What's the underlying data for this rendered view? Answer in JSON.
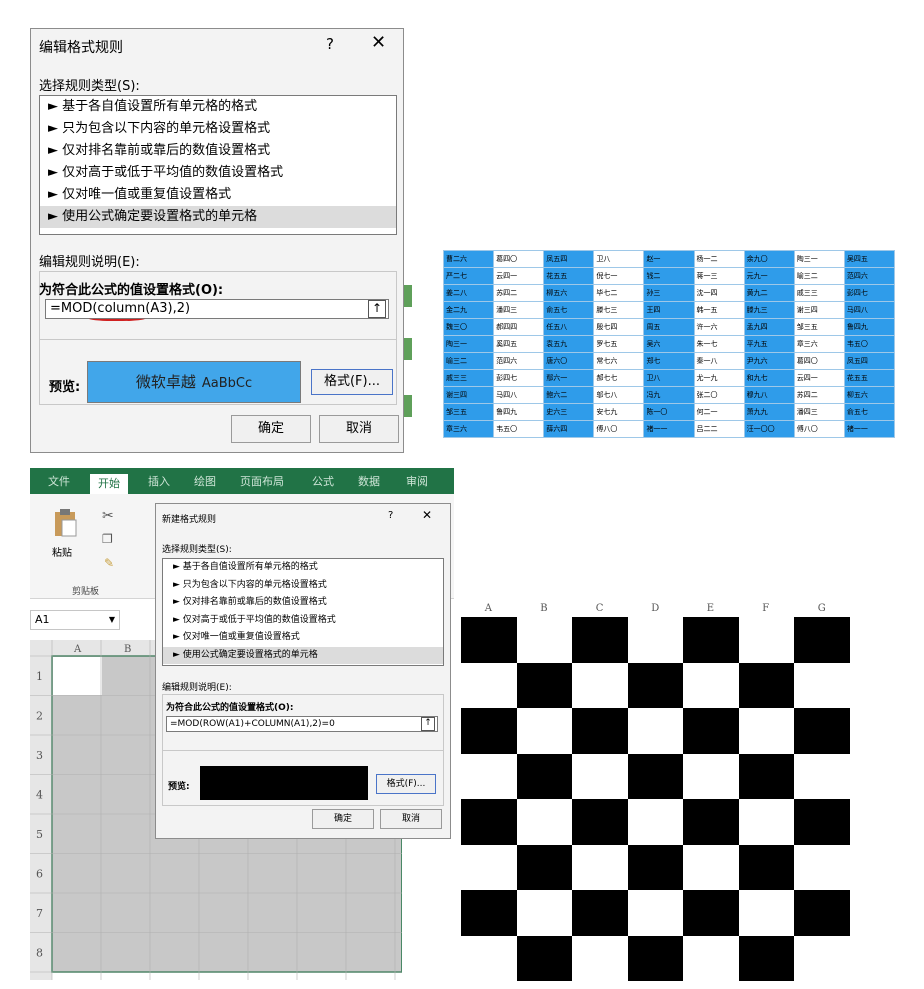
{
  "dialog1": {
    "title": "编辑格式规则",
    "help": "?",
    "close": "✕",
    "select_type_label": "选择规则类型(S):",
    "rule_types": [
      "► 基于各自值设置所有单元格的格式",
      "► 只为包含以下内容的单元格设置格式",
      "► 仅对排名靠前或靠后的数值设置格式",
      "► 仅对高于或低于平均值的数值设置格式",
      "► 仅对唯一值或重复值设置格式",
      "► 使用公式确定要设置格式的单元格"
    ],
    "edit_desc_label": "编辑规则说明(E):",
    "formula_label": "为符合此公式的值设置格式(O):",
    "formula_value": "=MOD(column(A3),2)",
    "preview_label": "预览:",
    "preview_text": "微软卓越",
    "preview_sample": "AaBbCc",
    "preview_color": "#41a6ea",
    "format_button": "格式(F)...",
    "ok_button": "确定",
    "cancel_button": "取消"
  },
  "name_table": {
    "rows": [
      [
        "曹二六",
        "葛四〇",
        "凤五四",
        "卫八",
        "赵一",
        "杨一二",
        "余九〇",
        "陶三一",
        "吴四五"
      ],
      [
        "严二七",
        "云四一",
        "花五五",
        "倪七一",
        "钱二",
        "蒋一三",
        "元九一",
        "喻三二",
        "范四六"
      ],
      [
        "姜二八",
        "苏四二",
        "柳五六",
        "毕七二",
        "孙三",
        "沈一四",
        "黄九二",
        "戚三三",
        "彭四七"
      ],
      [
        "金二九",
        "潘四三",
        "俞五七",
        "滕七三",
        "王四",
        "韩一五",
        "滕九三",
        "谢三四",
        "马四八"
      ],
      [
        "魏三〇",
        "郝四四",
        "任五八",
        "殷七四",
        "周五",
        "许一六",
        "孟九四",
        "邹三五",
        "鲁四九"
      ],
      [
        "陶三一",
        "奚四五",
        "袁五九",
        "罗七五",
        "吴六",
        "朱一七",
        "平九五",
        "章三六",
        "韦五〇"
      ],
      [
        "喻三二",
        "范四六",
        "唐六〇",
        "常七六",
        "郑七",
        "秦一八",
        "尹九六",
        "葛四〇",
        "凤五四"
      ],
      [
        "戚三三",
        "彭四七",
        "鄢六一",
        "郝七七",
        "卫八",
        "尤一九",
        "和九七",
        "云四一",
        "花五五"
      ],
      [
        "谢三四",
        "马四八",
        "鲍六二",
        "邬七八",
        "冯九",
        "张二〇",
        "穆九八",
        "苏四二",
        "柳五六"
      ],
      [
        "邹三五",
        "鲁四九",
        "史六三",
        "安七九",
        "陈一〇",
        "何二一",
        "萧九九",
        "潘四三",
        "俞五七"
      ],
      [
        "章三六",
        "韦五〇",
        "薛六四",
        "傅八〇",
        "褚一一",
        "吕二二",
        "汪一〇〇",
        "傅八〇",
        "褚一一"
      ]
    ],
    "highlight_color": "#2f9cea"
  },
  "excel": {
    "tabs": [
      "文件",
      "开始",
      "插入",
      "绘图",
      "页面布局",
      "公式",
      "数据",
      "审阅"
    ],
    "paste_label": "粘贴",
    "clipboard_label": "剪贴板",
    "name_box": "A1",
    "col_headers": [
      "A",
      "B"
    ],
    "row_headers": [
      "1",
      "2",
      "3",
      "4",
      "5",
      "6",
      "7",
      "8"
    ],
    "brand_color": "#217346"
  },
  "dialog2": {
    "title": "新建格式规则",
    "help": "?",
    "close": "✕",
    "select_type_label": "选择规则类型(S):",
    "rule_types": [
      "► 基于各自值设置所有单元格的格式",
      "► 只为包含以下内容的单元格设置格式",
      "► 仅对排名靠前或靠后的数值设置格式",
      "► 仅对高于或低于平均值的数值设置格式",
      "► 仅对唯一值或重复值设置格式",
      "► 使用公式确定要设置格式的单元格"
    ],
    "edit_desc_label": "编辑规则说明(E):",
    "formula_label": "为符合此公式的值设置格式(O):",
    "formula_value": "=MOD(ROW(A1)+COLUMN(A1),2)=0",
    "preview_label": "预览:",
    "preview_color": "#000000",
    "format_button": "格式(F)...",
    "ok_button": "确定",
    "cancel_button": "取消"
  },
  "checkerboard": {
    "col_headers": [
      "A",
      "B",
      "C",
      "D",
      "E",
      "F",
      "G"
    ],
    "rows": 8,
    "cols": 7,
    "fill_color": "#000000"
  }
}
